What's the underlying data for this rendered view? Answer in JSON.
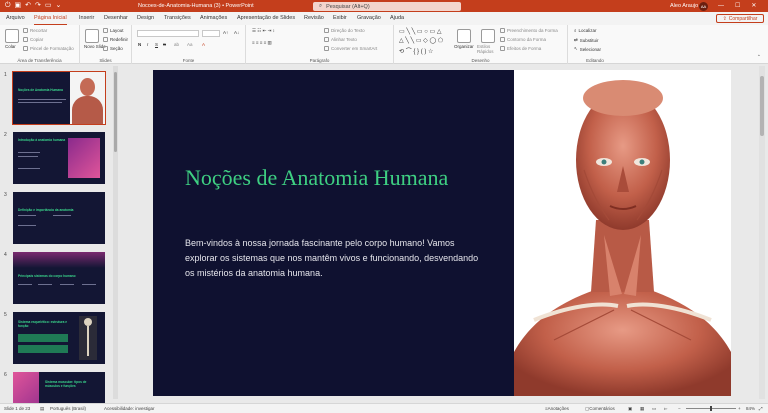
{
  "window": {
    "doc_title": "Nocoes-de-Anatomia-Humana (3)  •  PowerPoint",
    "search_placeholder": "Pesquisar (Alt+Q)",
    "user_name": "Aleo Araujo",
    "user_initials": "AA"
  },
  "tabs": [
    {
      "label": "Arquivo",
      "active": false
    },
    {
      "label": "Página Inicial",
      "active": true
    },
    {
      "label": "Inserir",
      "active": false
    },
    {
      "label": "Desenhar",
      "active": false
    },
    {
      "label": "Design",
      "active": false
    },
    {
      "label": "Transições",
      "active": false
    },
    {
      "label": "Animações",
      "active": false
    },
    {
      "label": "Apresentação de Slides",
      "active": false
    },
    {
      "label": "Revisão",
      "active": false
    },
    {
      "label": "Exibir",
      "active": false
    },
    {
      "label": "Gravação",
      "active": false
    },
    {
      "label": "Ajuda",
      "active": false
    }
  ],
  "share_label": "Compartilhar",
  "ribbon": {
    "clipboard": {
      "label": "Área de Transferência",
      "paste": "Colar",
      "cut": "Recortar",
      "copy": "Copiar",
      "format_painter": "Pincel de Formatação"
    },
    "slides": {
      "label": "Slides",
      "new_slide": "Novo Slide",
      "layout": "Layout",
      "reset": "Redefinir",
      "section": "Seção"
    },
    "font": {
      "label": "Fonte",
      "bold": "N",
      "italic": "I",
      "underline": "S",
      "strike": "S"
    },
    "paragraph": {
      "label": "Parágrafo",
      "text_direction": "Direção do Texto",
      "align_text": "Alinhar Texto",
      "convert_smartart": "Converter em SmartArt"
    },
    "drawing": {
      "label": "Desenho",
      "arrange": "Organizar",
      "quick_styles": "Estilos Rápidos",
      "shape_fill": "Preenchimento da Forma",
      "shape_outline": "Contorno da Forma",
      "shape_effects": "Efeitos de Forma"
    },
    "editing": {
      "label": "Editando",
      "find": "Localizar",
      "replace": "Substituir",
      "select": "Selecionar"
    }
  },
  "thumbnails": [
    {
      "num": "1",
      "title": "Noções de Anatomia Humana",
      "selected": true
    },
    {
      "num": "2",
      "title": "Introdução à anatomia humana",
      "selected": false
    },
    {
      "num": "3",
      "title": "Definição e importância da anatomia",
      "selected": false
    },
    {
      "num": "4",
      "title": "Principais sistemas do corpo humano",
      "selected": false
    },
    {
      "num": "5",
      "title": "Sistema esquelético: estrutura e função",
      "selected": false
    },
    {
      "num": "6",
      "title": "Sistema muscular: tipos de músculos e funções",
      "selected": false
    }
  ],
  "slide": {
    "title": "Noções de Anatomia Humana",
    "body": "Bem-vindos à nossa jornada fascinante pelo corpo humano! Vamos explorar os sistemas que nos mantêm vivos e funcionando, desvendando os mistérios da anatomia humana."
  },
  "status": {
    "slide_count": "Slide 1 de 23",
    "language": "Português (Brasil)",
    "accessibility": "Acessibilidade: investigar",
    "notes": "Anotações",
    "comments": "Comentários",
    "zoom": "84%"
  },
  "colors": {
    "accent": "#c43e1c",
    "slide_bg": "#0f1130",
    "title_green": "#3ecf82"
  }
}
